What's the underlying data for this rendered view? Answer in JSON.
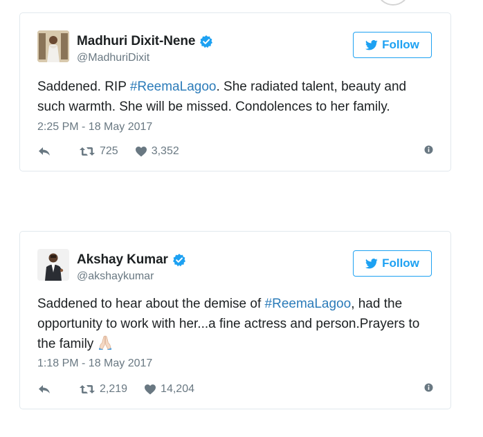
{
  "tweets": [
    {
      "display_name": "Madhuri Dixit-Nene",
      "handle": "@MadhuriDixit",
      "follow_label": "Follow",
      "text_before": "Saddened. RIP ",
      "hashtag": "#ReemaLagoo",
      "text_after": ". She radiated talent, beauty and such warmth. She will be missed. Condolences to her family.",
      "timestamp": "2:25 PM - 18 May 2017",
      "retweets": "725",
      "likes": "3,352"
    },
    {
      "display_name": "Akshay Kumar",
      "handle": "@akshaykumar",
      "follow_label": "Follow",
      "text_before": "Saddened to hear about the demise of ",
      "hashtag": "#ReemaLagoo",
      "text_after": ", had the opportunity to work with her...a fine actress and person.Prayers to the family ",
      "emoji": "folded-hands-icon",
      "timestamp": "1:18 PM - 18 May 2017",
      "retweets": "2,219",
      "likes": "14,204"
    }
  ],
  "colors": {
    "accent": "#1da1f2",
    "hashtag": "#2b7bb9",
    "muted": "#697882",
    "border": "#e1e8ed"
  }
}
